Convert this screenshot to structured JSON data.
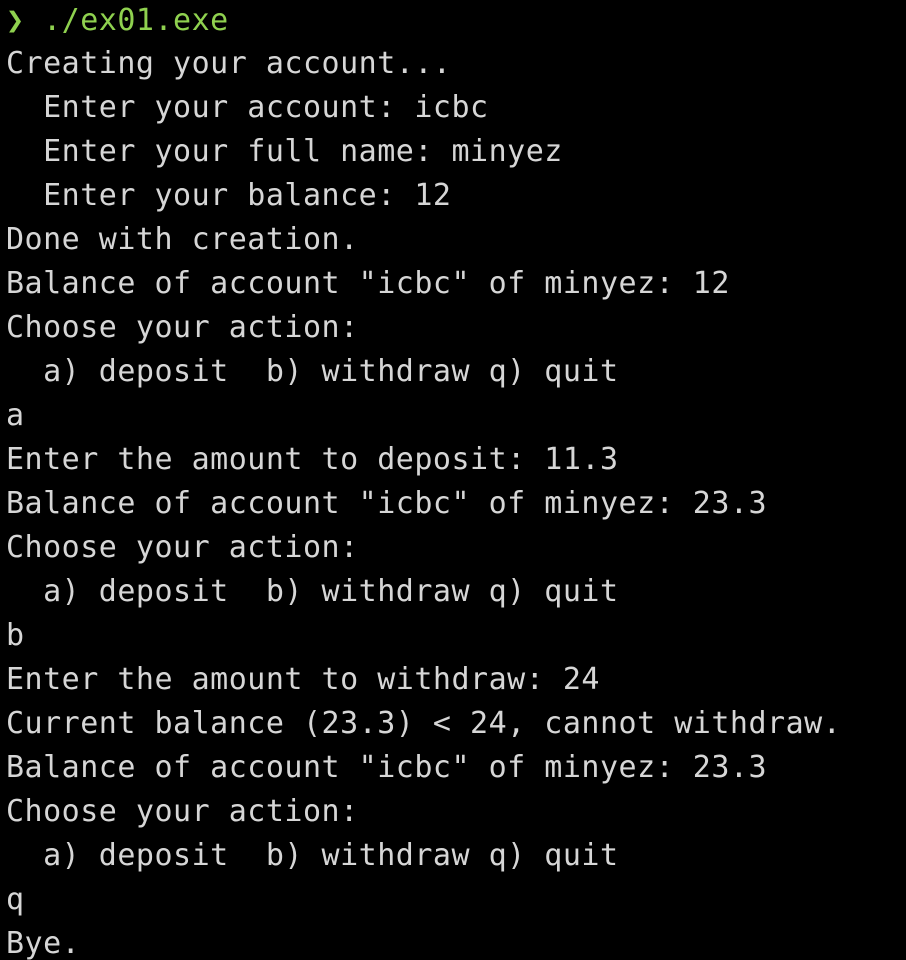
{
  "terminal": {
    "colors": {
      "background": "#000000",
      "text": "#d6d6d6",
      "prompt": "#8fd14f"
    },
    "prompt": {
      "symbol": "❯",
      "command": "./ex01.exe"
    },
    "lines": [
      "Creating your account...",
      "  Enter your account: icbc",
      "  Enter your full name: minyez",
      "  Enter your balance: 12",
      "Done with creation.",
      "Balance of account \"icbc\" of minyez: 12",
      "Choose your action:",
      "  a) deposit  b) withdraw q) quit",
      "a",
      "Enter the amount to deposit: 11.3",
      "Balance of account \"icbc\" of minyez: 23.3",
      "Choose your action:",
      "  a) deposit  b) withdraw q) quit",
      "b",
      "Enter the amount to withdraw: 24",
      "Current balance (23.3) < 24, cannot withdraw.",
      "Balance of account \"icbc\" of minyez: 23.3",
      "Choose your action:",
      "  a) deposit  b) withdraw q) quit",
      "q",
      "Bye."
    ]
  }
}
